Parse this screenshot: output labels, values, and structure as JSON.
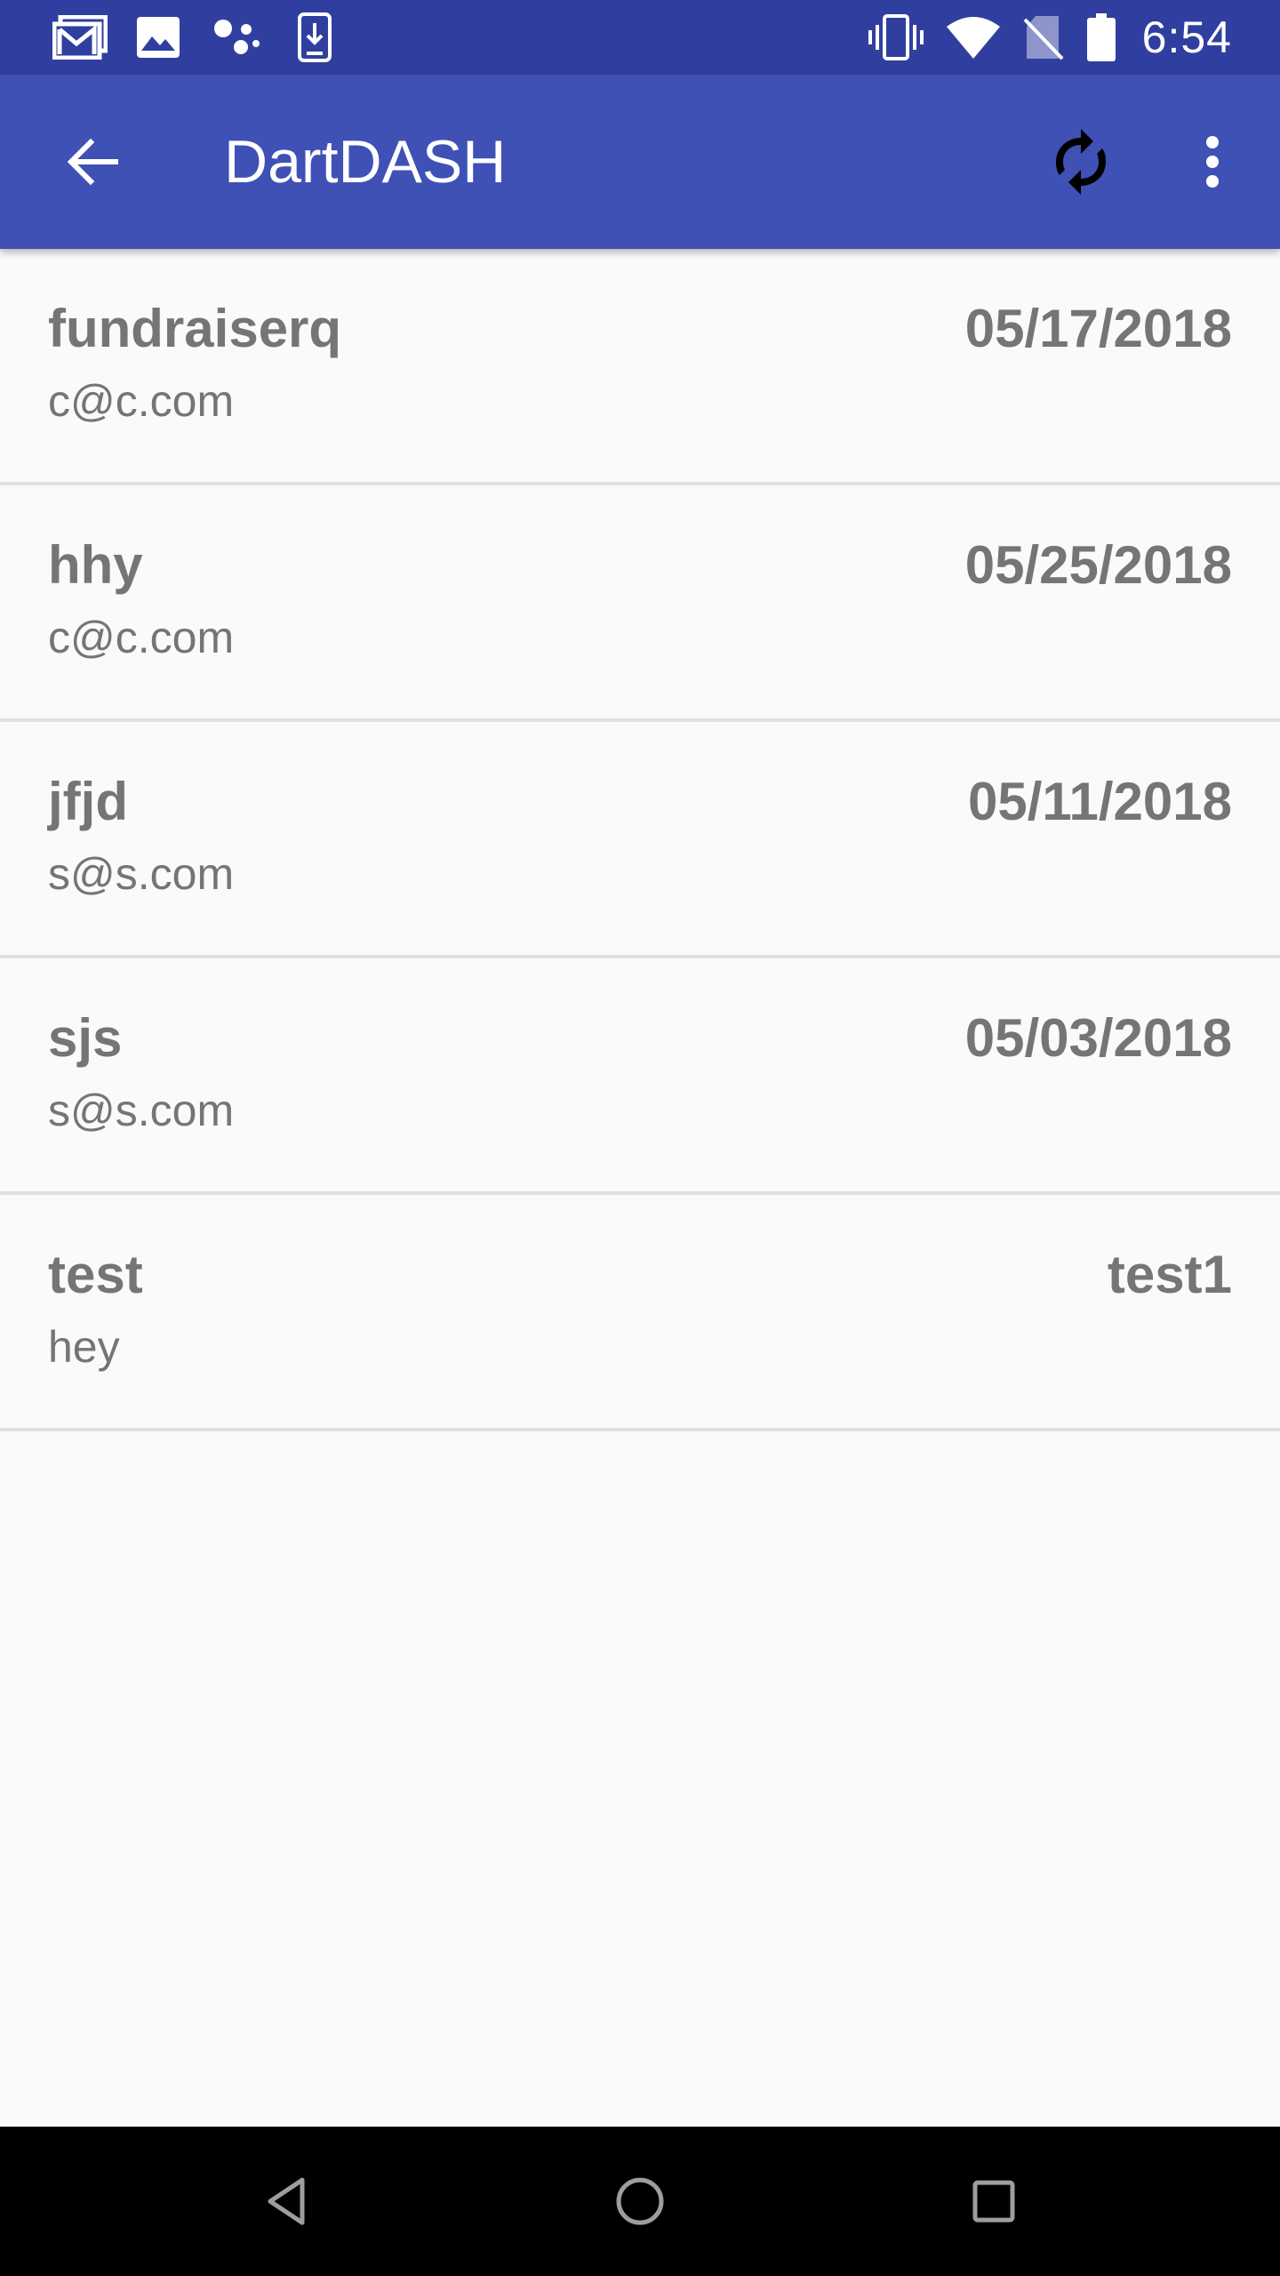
{
  "status_bar": {
    "time": "6:54",
    "left_icons": [
      "gmail-icon",
      "image-icon",
      "assistant-icon",
      "download-icon"
    ],
    "right_icons": [
      "vibrate-icon",
      "wifi-icon",
      "no-sim-icon",
      "battery-icon"
    ]
  },
  "app_bar": {
    "title": "DartDASH",
    "background": "#3f51b5",
    "status_bar_color": "#303f9f"
  },
  "items": [
    {
      "name": "fundraiserq",
      "email": "c@c.com",
      "date": "05/17/2018"
    },
    {
      "name": "hhy",
      "email": "c@c.com",
      "date": "05/25/2018"
    },
    {
      "name": "jfjd",
      "email": "s@s.com",
      "date": "05/11/2018"
    },
    {
      "name": "sjs",
      "email": "s@s.com",
      "date": "05/03/2018"
    },
    {
      "name": "test",
      "email": "hey",
      "date": "test1"
    }
  ],
  "nav_bar": {
    "buttons": [
      "back-nav-icon",
      "home-nav-icon",
      "recents-nav-icon"
    ]
  }
}
